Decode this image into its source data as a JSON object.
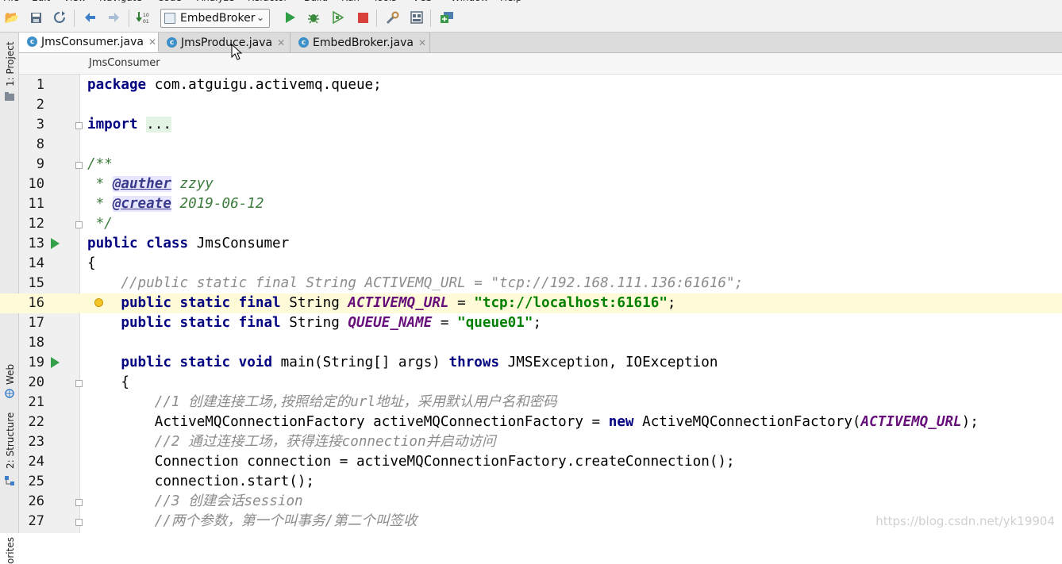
{
  "menubar": {
    "items": [
      "File",
      "Edit",
      "View",
      "Navigate",
      "Code",
      "Analyze",
      "Refactor",
      "Build",
      "Run",
      "Tools",
      "VCS",
      "Window",
      "Help"
    ]
  },
  "toolbar": {
    "run_config": "EmbedBroker",
    "icons": [
      "open-folder-icon",
      "save-icon",
      "sync-icon",
      "back-icon",
      "forward-icon",
      "build-icon",
      "run-icon",
      "debug-icon",
      "coverage-icon",
      "stop-icon",
      "settings-icon",
      "project-structure-icon",
      "deploy-icon"
    ]
  },
  "side_tools": {
    "project": "1: Project",
    "web": "Web",
    "structure": "2: Structure",
    "favorites": "orites"
  },
  "tabs": [
    {
      "label": "JmsConsumer.java",
      "active": true
    },
    {
      "label": "JmsProduce.java",
      "active": false
    },
    {
      "label": "EmbedBroker.java",
      "active": false
    }
  ],
  "breadcrumb": "JmsConsumer",
  "current_line": 16,
  "code": {
    "lines": [
      {
        "n": "1",
        "parts": [
          [
            "kw",
            "package"
          ],
          [
            "p",
            " com.atguigu.activemq.queue;"
          ]
        ]
      },
      {
        "n": "2",
        "parts": []
      },
      {
        "n": "3",
        "parts": [
          [
            "kw",
            "import"
          ],
          [
            "p",
            " "
          ],
          [
            "fold",
            "..."
          ]
        ]
      },
      {
        "n": "8",
        "parts": []
      },
      {
        "n": "9",
        "parts": [
          [
            "doc",
            "/**"
          ]
        ]
      },
      {
        "n": "10",
        "parts": [
          [
            "doc",
            " * "
          ],
          [
            "tag",
            "@auther"
          ],
          [
            "doc",
            " zzyy"
          ]
        ]
      },
      {
        "n": "11",
        "parts": [
          [
            "doc",
            " * "
          ],
          [
            "tag",
            "@create"
          ],
          [
            "doc",
            " 2019-06-12"
          ]
        ]
      },
      {
        "n": "12",
        "parts": [
          [
            "doc",
            " */"
          ]
        ]
      },
      {
        "n": "13",
        "parts": [
          [
            "kw",
            "public class"
          ],
          [
            "p",
            " JmsConsumer"
          ]
        ]
      },
      {
        "n": "14",
        "parts": [
          [
            "p",
            "{"
          ]
        ]
      },
      {
        "n": "15",
        "parts": [
          [
            "p",
            "    "
          ],
          [
            "cmt",
            "//public static final String ACTIVEMQ_URL = \"tcp://192.168.111.136:61616\";"
          ]
        ]
      },
      {
        "n": "16",
        "parts": [
          [
            "p",
            "    "
          ],
          [
            "kw",
            "public static final"
          ],
          [
            "p",
            " String "
          ],
          [
            "cst",
            "ACTIVEMQ_URL"
          ],
          [
            "p",
            " = "
          ],
          [
            "str",
            "\"tcp://localhost:61616\""
          ],
          [
            "p",
            ";"
          ]
        ]
      },
      {
        "n": "17",
        "parts": [
          [
            "p",
            "    "
          ],
          [
            "kw",
            "public static final"
          ],
          [
            "p",
            " String "
          ],
          [
            "cst",
            "QUEUE_NAME"
          ],
          [
            "p",
            " = "
          ],
          [
            "str",
            "\"queue01\""
          ],
          [
            "p",
            ";"
          ]
        ]
      },
      {
        "n": "18",
        "parts": []
      },
      {
        "n": "19",
        "parts": [
          [
            "p",
            "    "
          ],
          [
            "kw",
            "public static void"
          ],
          [
            "p",
            " main(String[] args) "
          ],
          [
            "kw",
            "throws"
          ],
          [
            "p",
            " JMSException, IOException"
          ]
        ]
      },
      {
        "n": "20",
        "parts": [
          [
            "p",
            "    {"
          ]
        ]
      },
      {
        "n": "21",
        "parts": [
          [
            "p",
            "        "
          ],
          [
            "cmt",
            "//1 创建连接工场,按照给定的url地址，采用默认用户名和密码"
          ]
        ]
      },
      {
        "n": "22",
        "parts": [
          [
            "p",
            "        ActiveMQConnectionFactory activeMQConnectionFactory = "
          ],
          [
            "kw",
            "new"
          ],
          [
            "p",
            " ActiveMQConnectionFactory("
          ],
          [
            "cst",
            "ACTIVEMQ_URL"
          ],
          [
            "p",
            ");"
          ]
        ]
      },
      {
        "n": "23",
        "parts": [
          [
            "p",
            "        "
          ],
          [
            "cmt",
            "//2 通过连接工场，获得连接connection并启动访问"
          ]
        ]
      },
      {
        "n": "24",
        "parts": [
          [
            "p",
            "        Connection connection = activeMQConnectionFactory.createConnection();"
          ]
        ]
      },
      {
        "n": "25",
        "parts": [
          [
            "p",
            "        connection.start();"
          ]
        ]
      },
      {
        "n": "26",
        "parts": [
          [
            "p",
            "        "
          ],
          [
            "cmt",
            "//3 创建会话session"
          ]
        ]
      },
      {
        "n": "27",
        "parts": [
          [
            "p",
            "        "
          ],
          [
            "cmt",
            "//两个参数，第一个叫事务/第二个叫签收"
          ]
        ]
      }
    ]
  },
  "watermark": "https://blog.csdn.net/yk19904"
}
